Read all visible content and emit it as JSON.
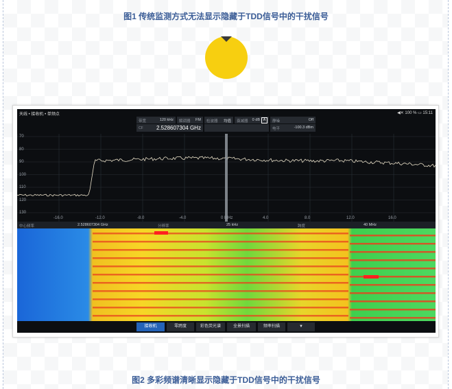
{
  "captions": {
    "fig1": "图1 传统监测方式无法显示隐藏于TDD信号中的干扰信号",
    "fig2": "图2 多彩频谱清晰显示隐藏于TDD信号中的干扰信号"
  },
  "status": {
    "breadcrumb": "天线 • 接收机 • 单频点",
    "battery": "100 %",
    "time": "15:11",
    "speaker_icon": "speaker-mute-icon",
    "battery_icon": "battery-icon"
  },
  "params": {
    "bandwidth": {
      "key": "带宽",
      "value": "120 kHz"
    },
    "demod": {
      "key": "解调器",
      "value": "FM"
    },
    "detector": {
      "key": "检波器",
      "value": "均值"
    },
    "atten": {
      "key": "衰减器",
      "value": "0 dB",
      "badge": "A"
    },
    "squelch": {
      "key": "静噪",
      "value": "Off"
    },
    "freq": {
      "key": "CF",
      "value": "2.528607304 GHz"
    },
    "level": {
      "key": "电平",
      "value": "-100.3 dBm"
    }
  },
  "plot": {
    "y_ticks": [
      "70",
      "80",
      "90",
      "100",
      "110",
      "120",
      "130"
    ],
    "x_ticks": [
      "-16.0",
      "-12.0",
      "-8.0",
      "-4.0",
      "0 MHz",
      "4.0",
      "8.0",
      "12.0",
      "16.0"
    ],
    "trace_color": "#e8dfc8"
  },
  "infobar": {
    "center_key": "中心频率",
    "center_value": "2.528607304 GHz",
    "resolution_key": "分辨率",
    "resolution_value": "25 kHz",
    "span_key": "跨度",
    "span_value": "40 MHz"
  },
  "buttons": [
    {
      "label": "接收机",
      "active": true
    },
    {
      "label": "零跨度",
      "active": false
    },
    {
      "label": "彩色荧光谱",
      "active": false
    },
    {
      "label": "全景扫描",
      "active": false
    },
    {
      "label": "频率扫描",
      "active": false
    },
    {
      "label": "▼",
      "active": false
    }
  ],
  "colors": {
    "accent": "#2563b8",
    "caption": "#3b5d97",
    "marker_circle": "#f7cf10"
  }
}
